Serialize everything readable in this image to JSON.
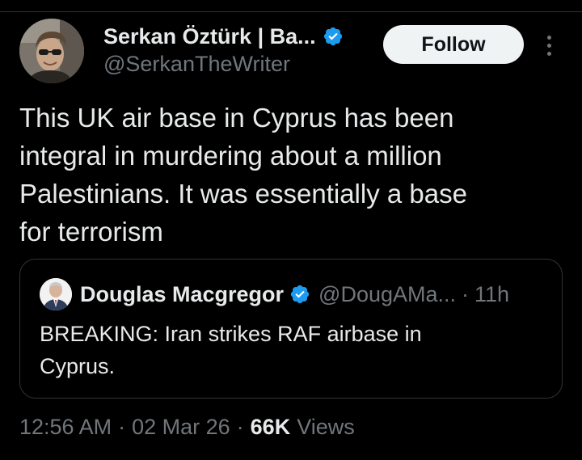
{
  "author": {
    "display_name": "Serkan Öztürk | Ba...",
    "handle": "@SerkanTheWriter",
    "verified": true,
    "avatar": "profile-photo"
  },
  "actions": {
    "follow_label": "Follow",
    "more_icon": "more-vertical-icon"
  },
  "tweet": {
    "text": "This UK air base in Cyprus has been\nintegral in murdering about a million\nPalestinians. It was essentially a base\nfor terrorism"
  },
  "quote": {
    "display_name": "Douglas Macgregor",
    "handle": "@DougAMa...",
    "separator": "·",
    "time": "11h",
    "verified": true,
    "text": "BREAKING: Iran strikes RAF airbase in\nCyprus."
  },
  "meta": {
    "time": "12:56 AM",
    "separator": "·",
    "date": "02 Mar 26",
    "views_count": "66K",
    "views_label": "Views"
  },
  "colors": {
    "background": "#000000",
    "primary_text": "#e7e9ea",
    "secondary_text": "#71767b",
    "verified_badge": "#1d9bf0",
    "follow_button_bg": "#eff3f4",
    "border": "#2f3336"
  }
}
